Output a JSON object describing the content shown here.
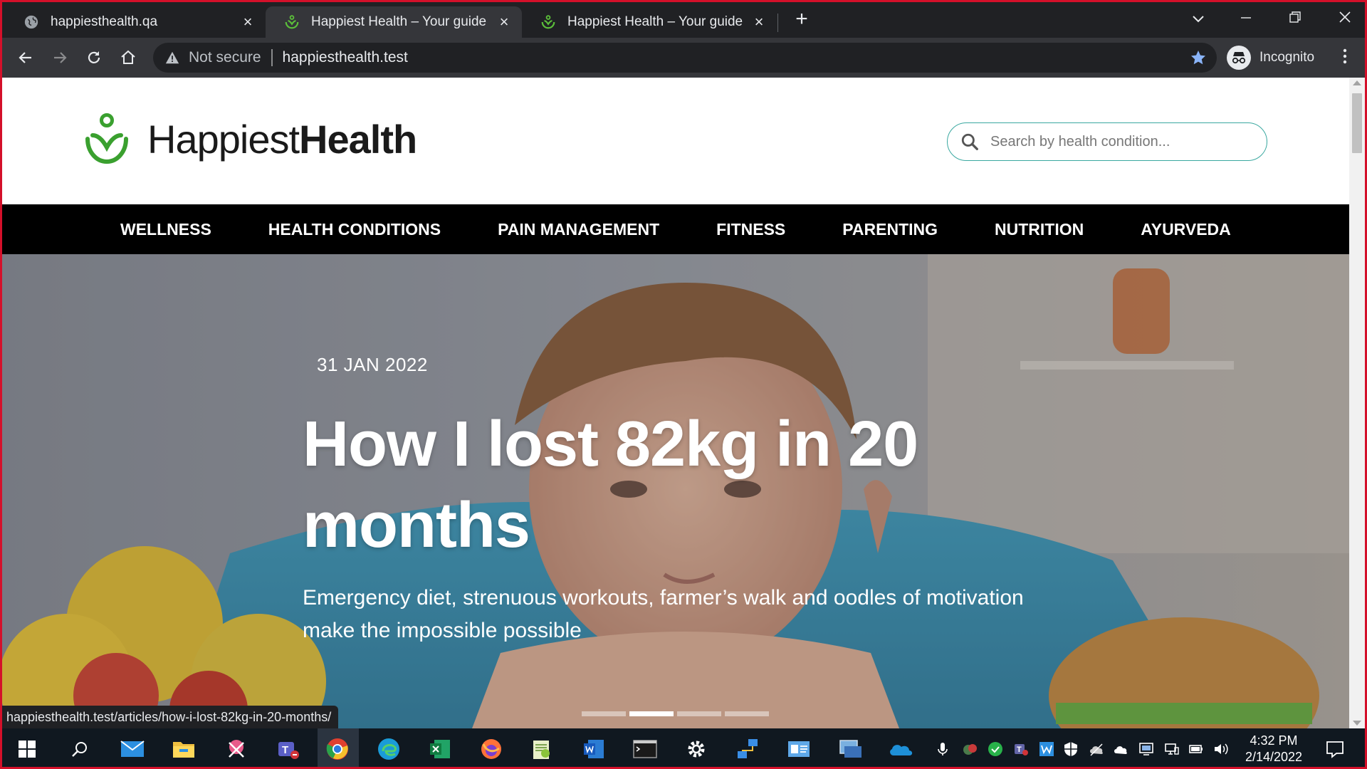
{
  "browser": {
    "tabs": [
      {
        "title": "happiesthealth.qa",
        "active": false
      },
      {
        "title": "Happiest Health – Your guide for",
        "active": true
      },
      {
        "title": "Happiest Health – Your guide for",
        "active": false
      }
    ],
    "new_tab": "+",
    "security_label": "Not secure",
    "url": "happiesthealth.test",
    "profile_label": "Incognito",
    "status_url": "happiesthealth.test/articles/how-i-lost-82kg-in-20-months/"
  },
  "site": {
    "logo_light": "Happiest",
    "logo_bold": "Health",
    "search_placeholder": "Search by health condition...",
    "nav": [
      "WELLNESS",
      "HEALTH CONDITIONS",
      "PAIN MANAGEMENT",
      "FITNESS",
      "PARENTING",
      "NUTRITION",
      "AYURVEDA"
    ],
    "brand_color": "#3aa02f",
    "hero": {
      "date": "31 JAN 2022",
      "title": "How I lost 82kg in 20 months",
      "subtitle": "Emergency diet, strenuous workouts, farmer’s walk and oodles of motivation make the impossible possible",
      "slides_total": 4,
      "slide_active": 2
    }
  },
  "taskbar": {
    "apps": [
      "start-icon",
      "search-icon",
      "mail-icon",
      "file-explorer-icon",
      "snipping-tool-icon",
      "teams-icon",
      "chrome-icon",
      "edge-icon",
      "excel-icon",
      "firefox-icon",
      "notepad-plus-plus-icon",
      "word-icon",
      "terminal-icon",
      "settings-icon",
      "network-tool-icon",
      "outlook-card-icon",
      "remote-desktop-icon",
      "onedrive-icon"
    ],
    "time": "4:32 PM",
    "date": "2/14/2022"
  }
}
